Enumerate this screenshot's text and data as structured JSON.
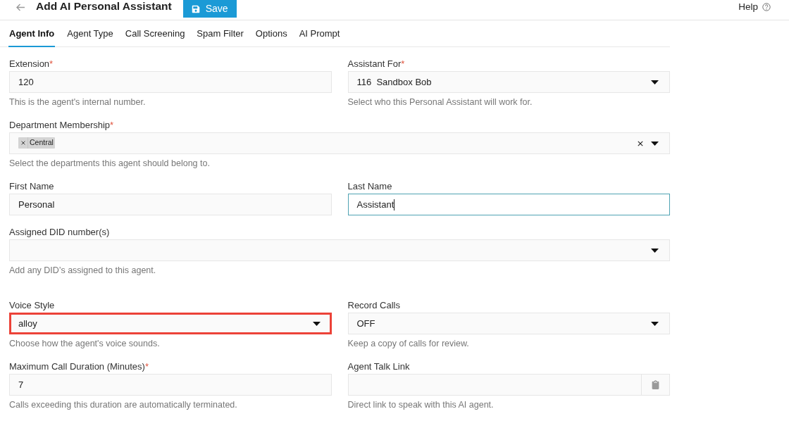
{
  "header": {
    "title": "Add AI Personal Assistant",
    "save_label": "Save",
    "help_label": "Help"
  },
  "tabs": [
    {
      "label": "Agent Info",
      "selected": true
    },
    {
      "label": "Agent Type",
      "selected": false
    },
    {
      "label": "Call Screening",
      "selected": false
    },
    {
      "label": "Spam Filter",
      "selected": false
    },
    {
      "label": "Options",
      "selected": false
    },
    {
      "label": "AI Prompt",
      "selected": false
    }
  ],
  "sections": [
    {
      "rows": [
        {
          "fields": [
            {
              "kind": "input",
              "label": "Extension",
              "required_mark": "*",
              "value": "120",
              "help": "This is the agent's internal number.",
              "focused": false,
              "highlighted": false
            },
            {
              "kind": "select",
              "label": "Assistant For",
              "required_mark": "*",
              "value": "116  Sandbox Bob",
              "help": "Select who this Personal Assistant will work for.",
              "highlighted": false
            }
          ]
        },
        {
          "fields": [
            {
              "kind": "multiselect",
              "label": "Department Membership",
              "required_mark": "*",
              "tags": [
                {
                  "label": "Central"
                }
              ],
              "help": "Select the departments this agent should belong to.",
              "highlighted": false
            }
          ]
        },
        {
          "fields": [
            {
              "kind": "input",
              "label": "First Name",
              "value": "Personal",
              "focused": false,
              "highlighted": false
            },
            {
              "kind": "input",
              "label": "Last Name",
              "value": "Assistant",
              "focused": true,
              "highlighted": false
            }
          ]
        },
        {
          "fields": [
            {
              "kind": "select",
              "label": "Assigned DID number(s)",
              "help": "Add any DID’s assigned to this agent.",
              "highlighted": false
            }
          ]
        }
      ]
    },
    {
      "rows": [
        {
          "fields": [
            {
              "kind": "select",
              "label": "Voice Style",
              "value": "alloy",
              "help": "Choose how the agent's voice sounds.",
              "highlighted": true
            },
            {
              "kind": "select",
              "label": "Record Calls",
              "value": "OFF",
              "help": "Keep a copy of calls for review.",
              "highlighted": false
            }
          ]
        },
        {
          "fields": [
            {
              "kind": "input",
              "label": "Maximum Call Duration (Minutes)",
              "required_mark": "*",
              "value": "7",
              "help": "Calls exceeding this duration are automatically terminated.",
              "focused": false,
              "highlighted": false
            },
            {
              "kind": "link",
              "label": "Agent Talk Link",
              "help": "Direct link to speak with this AI agent.",
              "highlighted": false
            }
          ]
        }
      ]
    }
  ]
}
